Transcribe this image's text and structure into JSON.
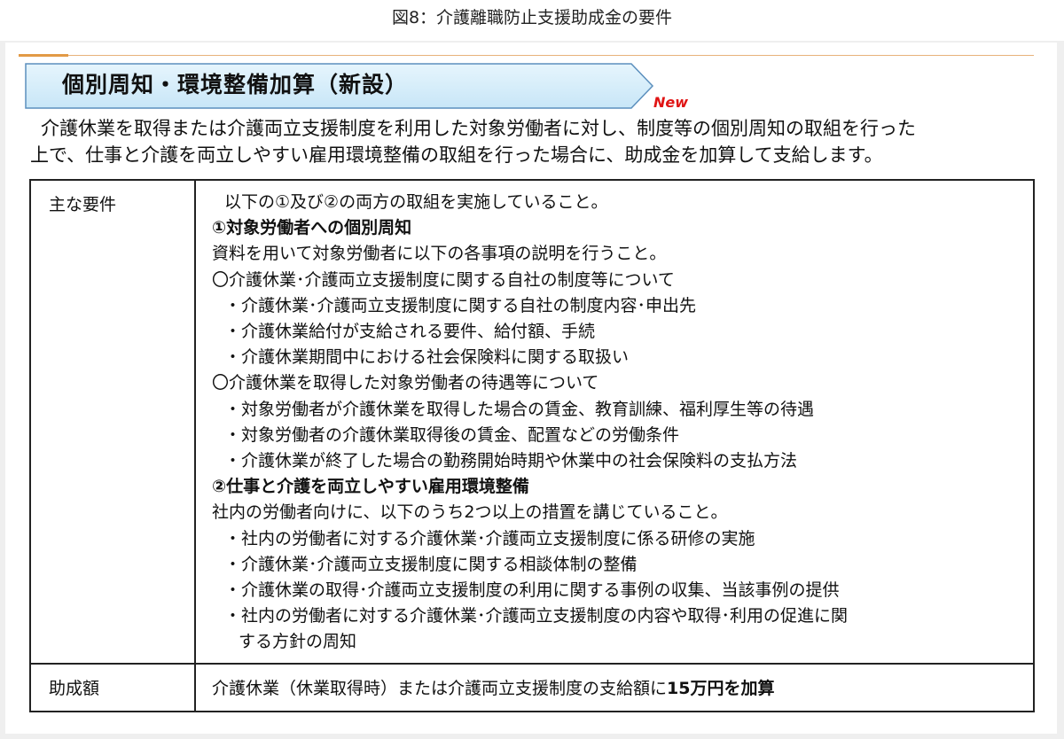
{
  "caption": "図8：介護離職防止支援助成金の要件",
  "banner": {
    "title": "個別周知・環境整備加算（新設）",
    "badge": "New"
  },
  "intro": [
    "介護休業を取得または介護両立支援制度を利用した対象労働者に対し、制度等の個別周知の取組を行った",
    "上で、仕事と介護を両立しやすい雇用環境整備の取組を行った場合に、助成金を加算して支給します。"
  ],
  "table": {
    "row1_label": "主な要件",
    "row1_lines": [
      "以下の①及び②の両方の取組を実施していること。",
      "①対象労働者への個別周知",
      "資料を用いて対象労働者に以下の各事項の説明を行うこと。",
      "〇介護休業･介護両立支援制度に関する自社の制度等について",
      "・介護休業･介護両立支援制度に関する自社の制度内容･申出先",
      "・介護休業給付が支給される要件、給付額、手続",
      "・介護休業期間中における社会保険料に関する取扱い",
      "〇介護休業を取得した対象労働者の待遇等について",
      "・対象労働者が介護休業を取得した場合の賃金、教育訓練、福利厚生等の待遇",
      "・対象労働者の介護休業取得後の賃金、配置などの労働条件",
      "・介護休業が終了した場合の勤務開始時期や休業中の社会保険料の支払方法",
      "②仕事と介護を両立しやすい雇用環境整備",
      "社内の労働者向けに、以下のうち2つ以上の措置を講じていること。",
      "・社内の労働者に対する介護休業･介護両立支援制度に係る研修の実施",
      "・介護休業･介護両立支援制度に関する相談体制の整備",
      "・介護休業の取得･介護両立支援制度の利用に関する事例の収集、当該事例の提供",
      "・社内の労働者に対する介護休業･介護両立支援制度の内容や取得･利用の促進に関",
      "する方針の周知"
    ],
    "row2_label": "助成額",
    "row2_text": "介護休業（休業取得時）または介護両立支援制度の支給額に",
    "row2_bold": "15万円を加算"
  },
  "colors": {
    "banner_fill": "#d5eefb",
    "banner_stroke": "#5b8fbd",
    "accent_orange": "#e29a46",
    "new_red": "#e01414"
  }
}
